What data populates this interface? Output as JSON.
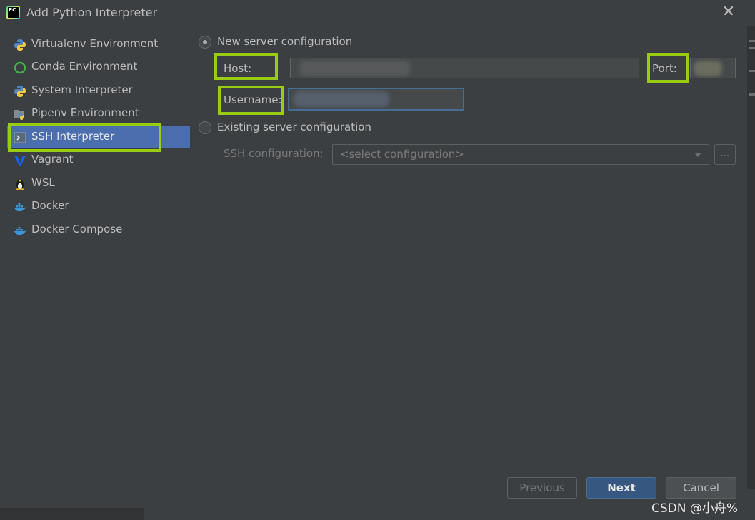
{
  "window": {
    "title": "Add Python Interpreter",
    "logo_text": "PC"
  },
  "sidebar": {
    "items": [
      {
        "label": "Virtualenv Environment",
        "icon": "python-icon"
      },
      {
        "label": "Conda Environment",
        "icon": "conda-icon"
      },
      {
        "label": "System Interpreter",
        "icon": "python-icon"
      },
      {
        "label": "Pipenv Environment",
        "icon": "pipenv-icon"
      },
      {
        "label": "SSH Interpreter",
        "icon": "ssh-terminal-icon",
        "selected": true
      },
      {
        "label": "Vagrant",
        "icon": "vagrant-icon"
      },
      {
        "label": "WSL",
        "icon": "linux-tux-icon"
      },
      {
        "label": "Docker",
        "icon": "docker-icon"
      },
      {
        "label": "Docker Compose",
        "icon": "docker-icon"
      }
    ]
  },
  "new_server": {
    "radio_label": "New server configuration",
    "selected": true,
    "host_label": "Host:",
    "host_value": "",
    "port_label": "Port:",
    "port_value": "",
    "username_label": "Username:",
    "username_value": ""
  },
  "existing_server": {
    "radio_label": "Existing server configuration",
    "selected": false,
    "ssh_config_label": "SSH configuration:",
    "ssh_config_placeholder": "<select configuration>",
    "browse_label": "..."
  },
  "buttons": {
    "previous": "Previous",
    "next": "Next",
    "cancel": "Cancel"
  },
  "watermark": "CSDN @小舟%",
  "colors": {
    "highlight": "#9acd12",
    "selection": "#4b6eaf",
    "background": "#3c3f41"
  }
}
